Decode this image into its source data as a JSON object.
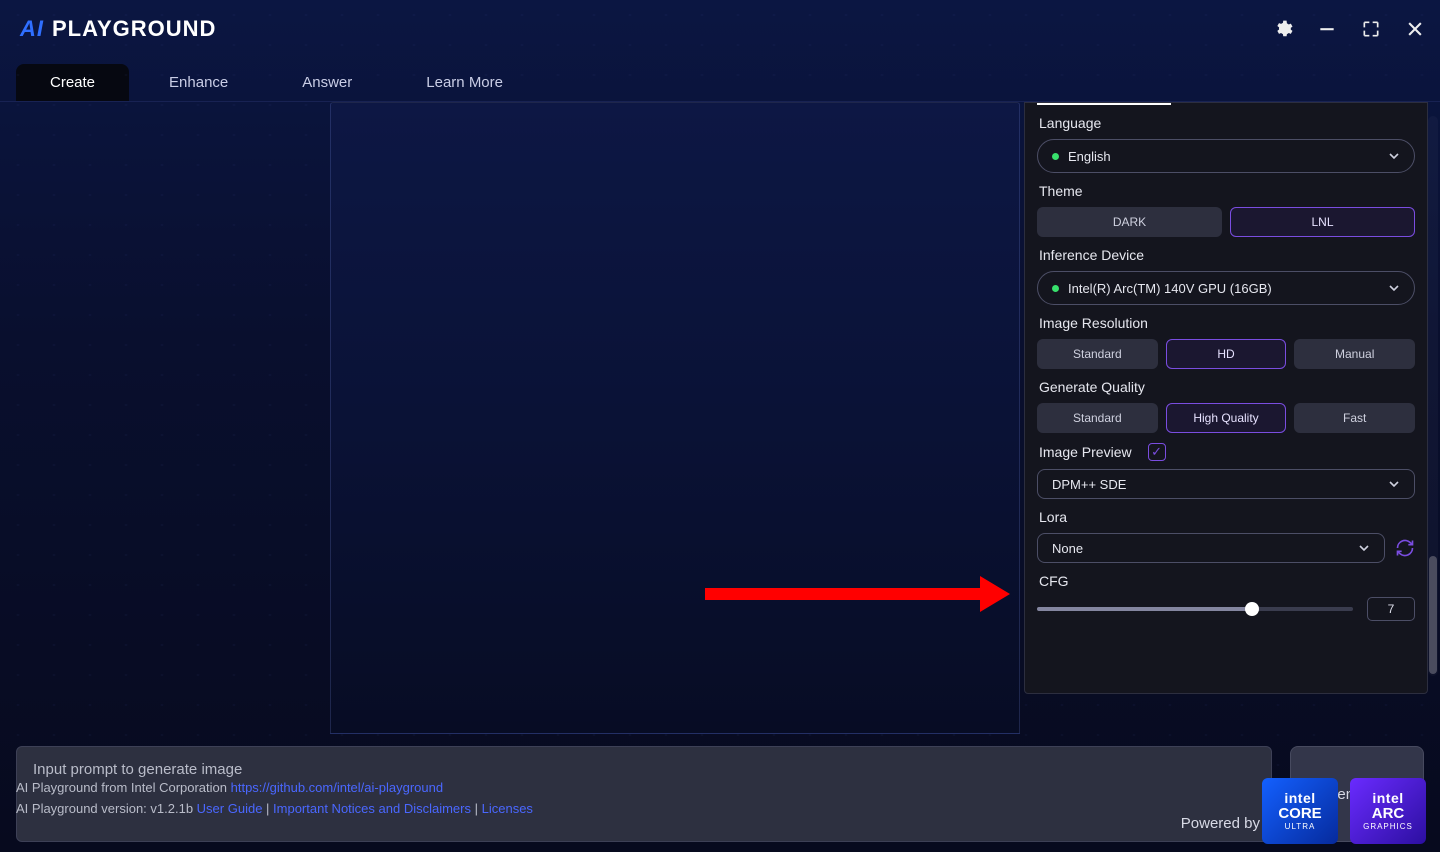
{
  "app": {
    "title_ai": "AI",
    "title_rest": "PLAYGROUND"
  },
  "tabs": [
    "Create",
    "Enhance",
    "Answer",
    "Learn More"
  ],
  "tabs_active": 0,
  "prompt": {
    "placeholder": "Input prompt to generate image"
  },
  "generate_label": "Generate",
  "settings": {
    "language": {
      "label": "Language",
      "value": "English"
    },
    "theme": {
      "label": "Theme",
      "options": [
        "DARK",
        "LNL"
      ],
      "selected": 1
    },
    "device": {
      "label": "Inference Device",
      "value": "Intel(R) Arc(TM) 140V GPU (16GB)"
    },
    "resolution": {
      "label": "Image Resolution",
      "options": [
        "Standard",
        "HD",
        "Manual"
      ],
      "selected": 1
    },
    "quality": {
      "label": "Generate Quality",
      "options": [
        "Standard",
        "High Quality",
        "Fast"
      ],
      "selected": 1
    },
    "preview": {
      "label": "Image Preview",
      "checked": true,
      "sampler": "DPM++ SDE"
    },
    "lora": {
      "label": "Lora",
      "value": "None"
    },
    "cfg": {
      "label": "CFG",
      "value": "7"
    }
  },
  "footer": {
    "line1_pre": "AI Playground from Intel Corporation ",
    "repo": "https://github.com/intel/ai-playground",
    "line2_pre": "AI Playground version: v1.2.1b ",
    "links": [
      "User Guide",
      "Important Notices and Disclaimers",
      "Licenses"
    ],
    "powered": "Powered by",
    "badge1": {
      "brand": "intel",
      "big": "CORE",
      "small": "ULTRA"
    },
    "badge2": {
      "brand": "intel",
      "big": "ARC",
      "small": "GRAPHICS"
    }
  }
}
